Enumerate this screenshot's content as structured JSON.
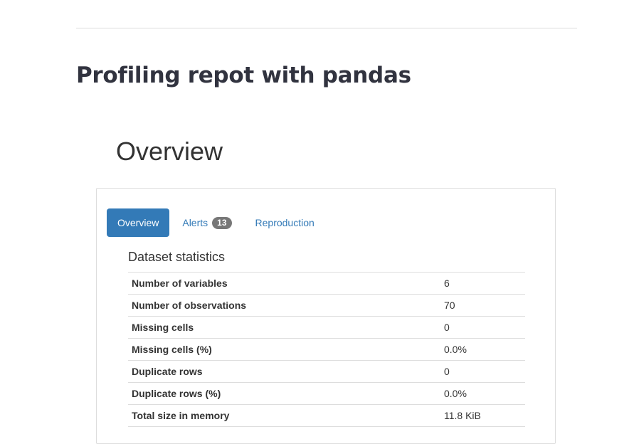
{
  "page": {
    "title": "Profiling repot with pandas"
  },
  "overview": {
    "heading": "Overview"
  },
  "tabs": [
    {
      "label": "Overview",
      "active": true
    },
    {
      "label": "Alerts",
      "badge": "13"
    },
    {
      "label": "Reproduction"
    }
  ],
  "dataset_statistics": {
    "title": "Dataset statistics",
    "rows": [
      {
        "label": "Number of variables",
        "value": "6"
      },
      {
        "label": "Number of observations",
        "value": "70"
      },
      {
        "label": "Missing cells",
        "value": "0"
      },
      {
        "label": "Missing cells (%)",
        "value": "0.0%"
      },
      {
        "label": "Duplicate rows",
        "value": "0"
      },
      {
        "label": "Duplicate rows (%)",
        "value": "0.0%"
      },
      {
        "label": "Total size in memory",
        "value": "11.8 KiB"
      }
    ]
  },
  "colors": {
    "accent": "#337ab7",
    "badge": "#777777"
  }
}
